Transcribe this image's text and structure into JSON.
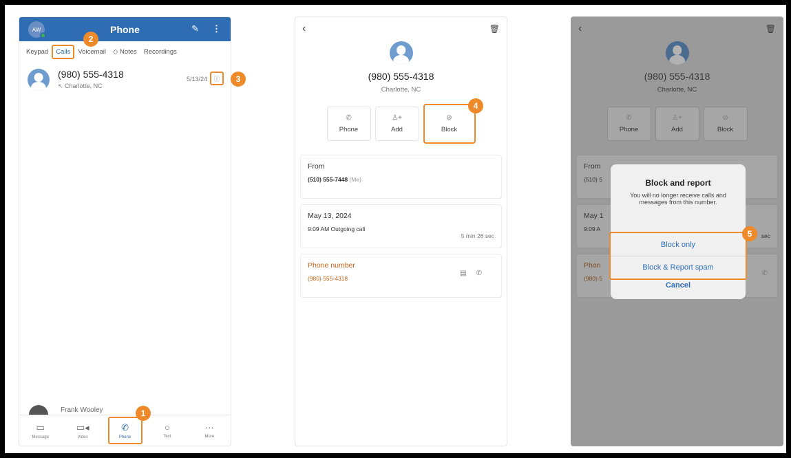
{
  "colors": {
    "accent": "#2e6db4",
    "highlight": "#ef8a2a"
  },
  "panel1": {
    "header": {
      "avatar_initials": "AW",
      "title": "Phone",
      "edit_icon": "pencil-icon",
      "more_icon": "vertical-dots-icon"
    },
    "tabs": [
      "Keypad",
      "Calls",
      "Voicemail",
      "Notes",
      "Recordings"
    ],
    "call": {
      "number": "(980) 555-4318",
      "location": "Charlotte, NC",
      "date": "5/13/24"
    },
    "peek_name": "Frank Wooley",
    "nav": [
      {
        "label": "Message",
        "icon": "chat-bubble-icon"
      },
      {
        "label": "Video",
        "icon": "video-icon"
      },
      {
        "label": "Phone",
        "icon": "phone-icon"
      },
      {
        "label": "Text",
        "icon": "speech-icon"
      },
      {
        "label": "More",
        "icon": "ellipsis-icon"
      }
    ]
  },
  "panel2": {
    "number": "(980) 555-4318",
    "location": "Charlotte, NC",
    "actions": [
      "Phone",
      "Add",
      "Block"
    ],
    "from": {
      "label": "From",
      "value": "(510) 555-7448",
      "suffix": "(Me)"
    },
    "call_detail": {
      "date": "May 13, 2024",
      "time_type": "9:09 AM  Outgoing call",
      "duration": "5 min 26 sec"
    },
    "phone_number": {
      "label": "Phone number",
      "value": "(980) 555-4318"
    }
  },
  "panel3": {
    "number": "(980) 555-4318",
    "location": "Charlotte, NC",
    "actions": [
      "Phone",
      "Add",
      "Block"
    ],
    "from_label": "From",
    "from_value": "(510) 5",
    "date_partial": "May 1",
    "time_partial": "9:09 A",
    "duration_partial": "sec",
    "phone_label_partial": "Phon",
    "phone_value_partial": "(980) 5",
    "dialog": {
      "title": "Block and report",
      "message": "You will no longer receive calls and messages from this number.",
      "option1": "Block only",
      "option2": "Block & Report spam",
      "cancel": "Cancel"
    }
  },
  "steps": [
    "1",
    "2",
    "3",
    "4",
    "5"
  ]
}
